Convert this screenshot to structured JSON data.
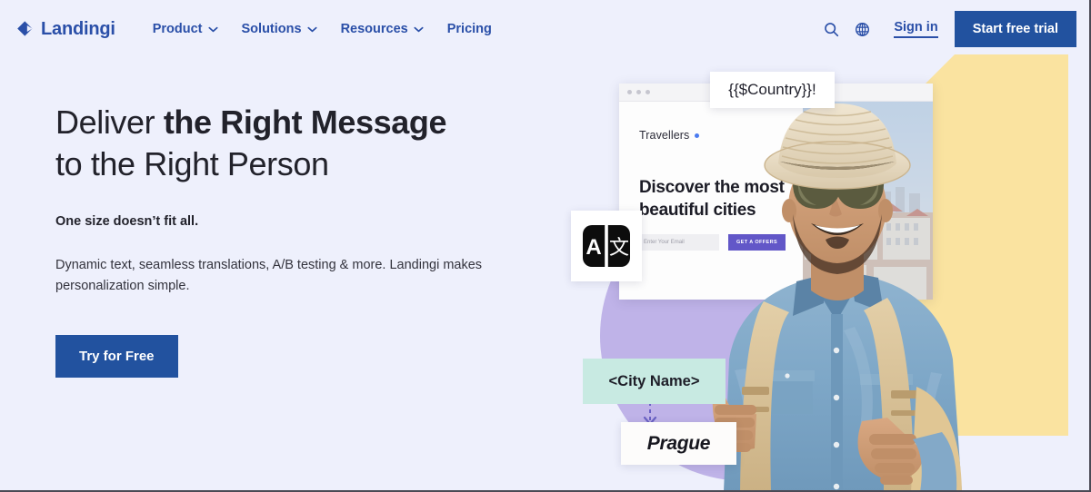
{
  "theme": {
    "bg": "#eef0fc",
    "brand_blue": "#2a4fa8",
    "button_blue": "#22529f",
    "yellow": "#fae3a0",
    "purple": "#bfb3e8",
    "mint": "#c8eae2",
    "mock_accent": "#6257c8"
  },
  "header": {
    "brand": {
      "name": "Landingi",
      "logo_icon": "landingi-diamond-logo"
    },
    "nav": [
      {
        "label": "Product",
        "has_dropdown": true
      },
      {
        "label": "Solutions",
        "has_dropdown": true
      },
      {
        "label": "Resources",
        "has_dropdown": true
      },
      {
        "label": "Pricing",
        "has_dropdown": false
      }
    ],
    "search_icon": "search-icon",
    "language_icon": "globe-icon",
    "sign_in_label": "Sign in",
    "cta_label": "Start free trial"
  },
  "hero": {
    "headline_part1": "Deliver ",
    "headline_bold": "the Right Message",
    "headline_part2": "to the Right Person",
    "subhead": "One size doesn’t fit all.",
    "body": "Dynamic text, seamless translations, A/B testing & more. Landingi makes personalization simple.",
    "cta_label": "Try for Free"
  },
  "visual": {
    "browser_mock": {
      "brand": "Travellers",
      "heading": "Discover the most beautiful cities",
      "email_placeholder": "Enter Your Email",
      "form_button": "GET A OFFERS"
    },
    "callouts": {
      "country_token": "{{$Country}}!",
      "translate_icon_left": "A",
      "translate_icon_right": "文",
      "city_token": "<City Name>",
      "city_value": "Prague"
    },
    "photo_alt": "smiling-traveller-man-with-straw-hat-sunglasses-denim-shirt-and-backpack-over-prague-cityscape"
  }
}
